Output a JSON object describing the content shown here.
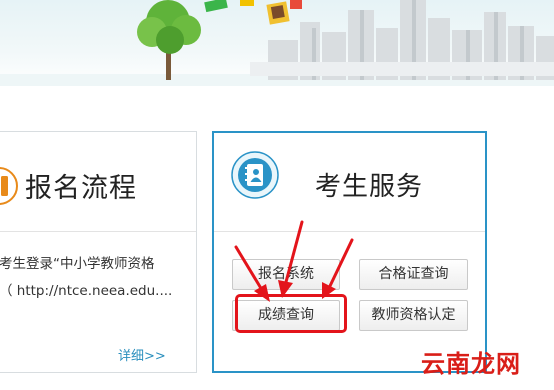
{
  "left_card": {
    "title": "报名流程",
    "desc_line1": "考生登录“中小学教师资格",
    "desc_line2": "（ http://ntce.neea.edu....",
    "more_link": "详细>>",
    "colors": {
      "icon": "#e88a1a",
      "link": "#2a8fbd"
    }
  },
  "right_card": {
    "title": "考生服务",
    "icon": "contacts-book-icon",
    "buttons": {
      "registration": "报名系统",
      "certificate_query": "合格证查询",
      "score_query": "成绩查询",
      "teacher_certification": "教师资格认定"
    },
    "colors": {
      "border": "#2a93c7",
      "highlight": "#e3141b"
    }
  },
  "watermark": "云南龙网"
}
